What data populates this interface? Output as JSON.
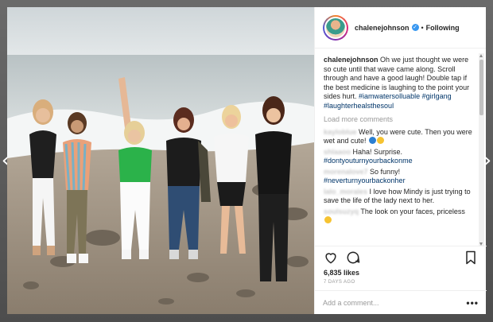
{
  "post": {
    "username": "chalenejohnson",
    "follow_label": "Following",
    "dot_separator": "•",
    "photo_alt": "Six women standing on a rocky beach smiling"
  },
  "caption": {
    "username": "chalenejohnson",
    "text": "Oh we just thought we were so cute until that wave came along. Scroll through and have a good laugh! Double tap if the best medicine is laughing to the point your sides hurt.",
    "tag1": "#iamwatersolluable",
    "tag2": "#girlgang",
    "tag3": "#laughterhealsthesoul"
  },
  "load_more_label": "Load more comments",
  "comments": [
    {
      "user": "kayloblue",
      "text": "Well, you were cute. Then you were wet and cute!",
      "tag": ""
    },
    {
      "user": "shlaaoo",
      "text": "Haha! Surprise.",
      "tag": "#dontyouturnyourbackonme"
    },
    {
      "user": "morenalove7",
      "text": "So funny!",
      "tag": "#neverturnyourbackonher"
    },
    {
      "user": "lalo_morales",
      "text": "I love how Mindy is just trying to save the life of the lady next to her.",
      "tag": ""
    },
    {
      "user": "soulsuzyq",
      "text": "The look on your faces, priceless",
      "tag": ""
    }
  ],
  "likes": "6,835 likes",
  "time_ago": "7 DAYS AGO",
  "add_comment_placeholder": "Add a comment...",
  "more_options": "•••",
  "nav": {
    "prev": "‹",
    "next": "›"
  },
  "colors": {
    "verified": "#3897f0",
    "hashtag": "#003569",
    "muted": "#999999"
  }
}
